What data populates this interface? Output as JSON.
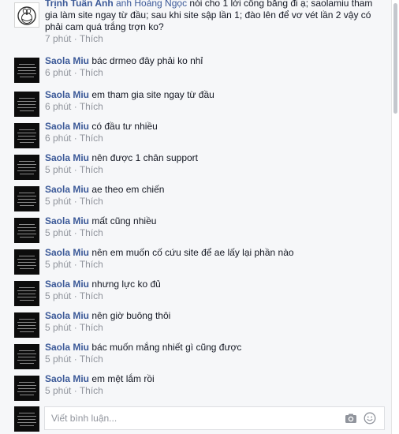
{
  "comments": [
    {
      "author": "Trịnh Tuấn Anh",
      "mention": "anh Hoàng Ngọc",
      "text_after_mention": " nói cho 1 lời công bằng đi ạ; saolamiu tham gia làm site ngay từ đầu; sau khi site sập lần 1; đào lên để vơ vét lần 2 vậy có phải cam quá trắng trợn ko?",
      "time": "7 phút",
      "like": "Thích"
    },
    {
      "author": "Saola Miu",
      "text": "bác drmeo đây phải ko nhỉ",
      "time": "6 phút",
      "like": "Thích"
    },
    {
      "author": "Saola Miu",
      "text": "em tham gia site ngay từ đầu",
      "time": "6 phút",
      "like": "Thích"
    },
    {
      "author": "Saola Miu",
      "text": "có đầu tư nhiều",
      "time": "6 phút",
      "like": "Thích"
    },
    {
      "author": "Saola Miu",
      "text": "nên được 1 chân support",
      "time": "5 phút",
      "like": "Thích"
    },
    {
      "author": "Saola Miu",
      "text": "ae theo em chiến",
      "time": "5 phút",
      "like": "Thích"
    },
    {
      "author": "Saola Miu",
      "text": "mất cũng nhiều",
      "time": "5 phút",
      "like": "Thích"
    },
    {
      "author": "Saola Miu",
      "text": "nên em muốn cố cứu site để ae lấy lại phần nào",
      "time": "5 phút",
      "like": "Thích"
    },
    {
      "author": "Saola Miu",
      "text": "nhưng lực ko đủ",
      "time": "5 phút",
      "like": "Thích"
    },
    {
      "author": "Saola Miu",
      "text": "nên giờ buông thôi",
      "time": "5 phút",
      "like": "Thích"
    },
    {
      "author": "Saola Miu",
      "text": "bác muốn mắng nhiết gì cũng được",
      "time": "5 phút",
      "like": "Thích"
    },
    {
      "author": "Saola Miu",
      "text": "em mệt lắm rồi",
      "time": "5 phút",
      "like": "Thích"
    }
  ],
  "composer": {
    "placeholder": "Viết bình luận...",
    "camera_icon": "camera-icon",
    "emoji_icon": "smiley-icon"
  },
  "colors": {
    "author": "#3b5998",
    "meta": "#90949c",
    "panel": "#f6f7f9"
  }
}
